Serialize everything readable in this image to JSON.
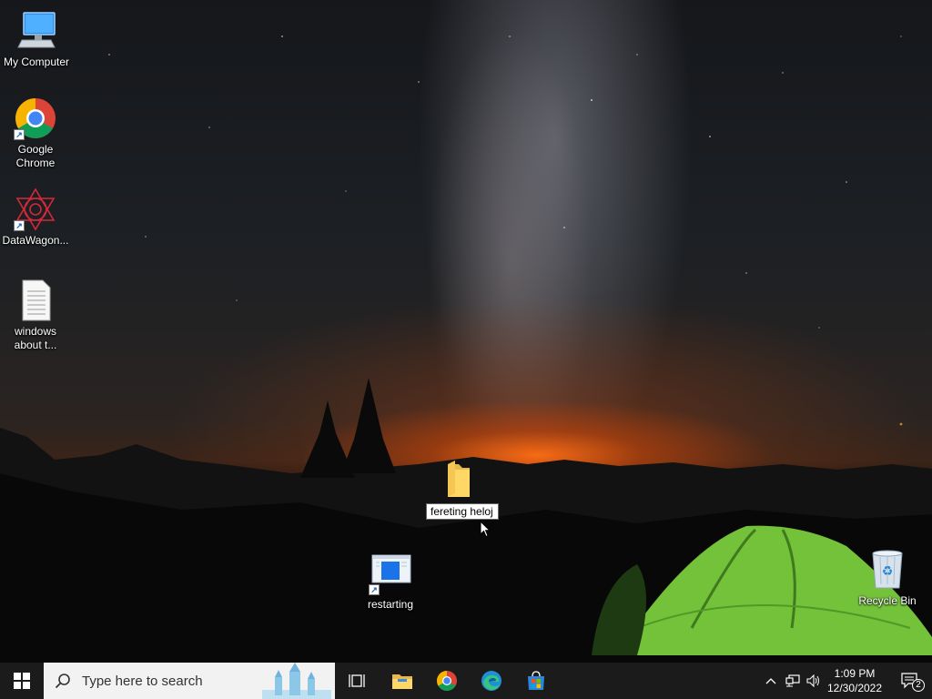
{
  "desktop": {
    "icons": [
      {
        "label": "My Computer",
        "icon": "my-computer-icon"
      },
      {
        "label": "Google Chrome",
        "icon": "chrome-icon",
        "shortcut": true
      },
      {
        "label": "DataWagon...",
        "icon": "datawagon-icon",
        "shortcut": true
      },
      {
        "label": "windows about t...",
        "icon": "text-document-icon"
      },
      {
        "label": "restarting",
        "icon": "app-window-icon",
        "shortcut": true
      },
      {
        "label": "Recycle Bin",
        "icon": "recycle-bin-icon"
      }
    ],
    "renaming_folder": {
      "value": "fereting heloj",
      "icon": "folder-icon"
    }
  },
  "taskbar": {
    "search_placeholder": "Type here to search",
    "pinned": [
      "task-view-icon",
      "file-explorer-icon",
      "chrome-icon",
      "edge-icon",
      "microsoft-store-icon"
    ],
    "tray": {
      "time": "1:09 PM",
      "date": "12/30/2022",
      "notification_count": "2"
    }
  },
  "colors": {
    "taskbar": "#1b1b1b",
    "search_box": "#f2f2f2",
    "accent": "#1a73e8"
  }
}
